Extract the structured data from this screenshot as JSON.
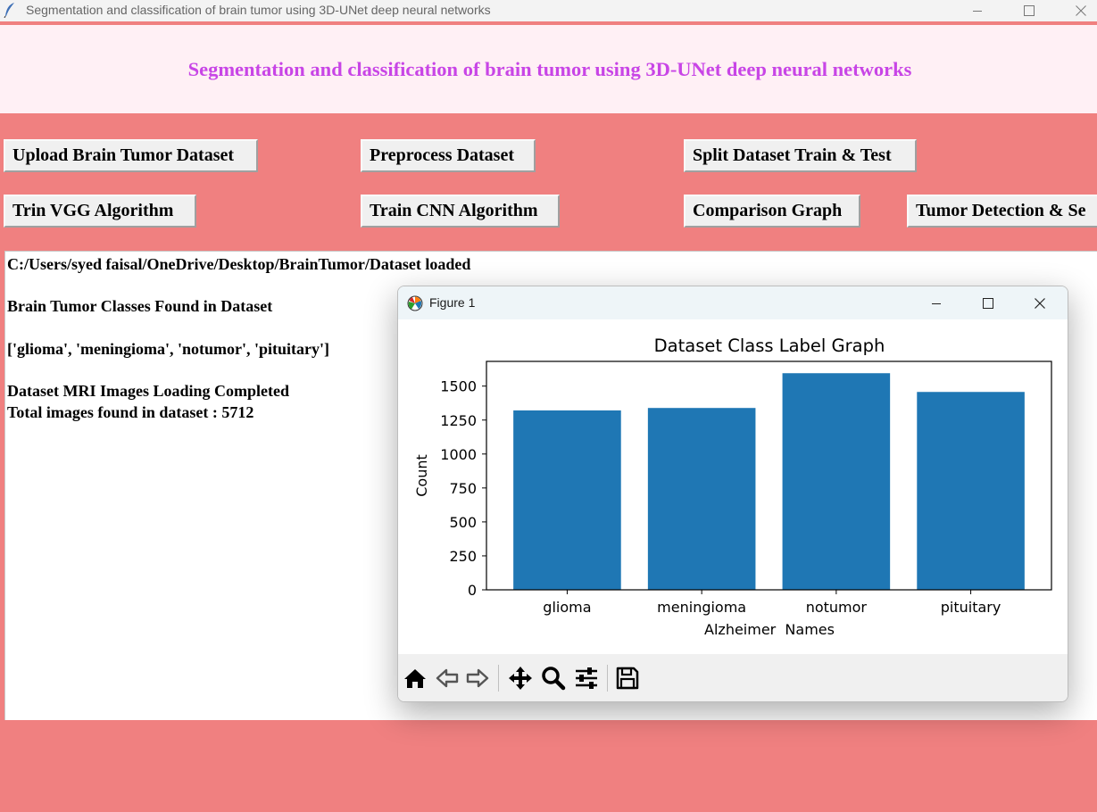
{
  "window": {
    "title": "Segmentation and classification of brain tumor using 3D-UNet deep neural networks"
  },
  "header": {
    "title": "Segmentation and classification of brain tumor using 3D-UNet deep neural networks"
  },
  "buttons": {
    "upload": "Upload Brain Tumor Dataset",
    "preprocess": "Preprocess Dataset",
    "split": "Split Dataset Train & Test",
    "train_vgg": "Trin VGG Algorithm",
    "train_cnn": "Train CNN Algorithm",
    "comparison": "Comparison Graph",
    "tumor_detection": "Tumor Detection & Se"
  },
  "output": {
    "lines": [
      "C:/Users/syed faisal/OneDrive/Desktop/BrainTumor/Dataset loaded",
      "Brain Tumor Classes Found in Dataset",
      "['glioma', 'meningioma', 'notumor', 'pituitary']",
      "Dataset MRI Images Loading Completed",
      "Total images found in dataset : 5712"
    ]
  },
  "figure_window": {
    "title": "Figure 1",
    "toolbar_icons": [
      "home-icon",
      "back-arrow-icon",
      "forward-arrow-icon",
      "pan-icon",
      "zoom-icon",
      "configure-subplots-icon",
      "save-icon"
    ]
  },
  "colors": {
    "background": "#f08080",
    "header_bg": "#fff0f5",
    "header_text": "#c845e6",
    "bar": "#1f77b4"
  },
  "chart_data": {
    "type": "bar",
    "title": "Dataset Class Label Graph",
    "xlabel": "Alzheimer  Names",
    "ylabel": "Count",
    "categories": [
      "glioma",
      "meningioma",
      "notumor",
      "pituitary"
    ],
    "values": [
      1321,
      1339,
      1595,
      1457
    ],
    "ylim": [
      0,
      1600
    ],
    "yticks": [
      "0",
      "250",
      "500",
      "750",
      "1000",
      "1250",
      "1500"
    ],
    "grid": false,
    "legend": "none"
  }
}
